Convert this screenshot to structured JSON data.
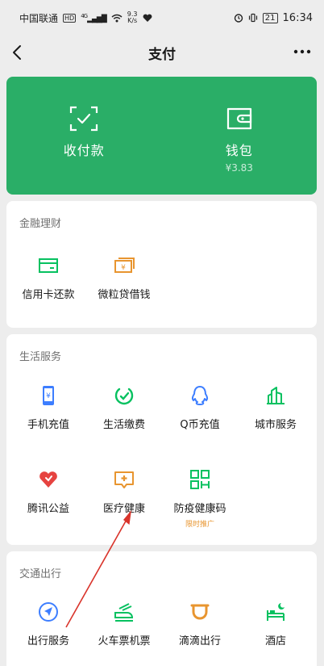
{
  "status_bar": {
    "carrier": "中国联通",
    "hd": "HD",
    "network": "4G",
    "speed_value": "9.3",
    "speed_unit": "K/s",
    "battery": "21",
    "time": "16:34"
  },
  "nav": {
    "title": "支付"
  },
  "hero": {
    "items": [
      {
        "label": "收付款",
        "sub": ""
      },
      {
        "label": "钱包",
        "sub": "¥3.83"
      }
    ]
  },
  "sections": [
    {
      "title": "金融理财",
      "items": [
        {
          "label": "信用卡还款",
          "icon": "credit-card-icon"
        },
        {
          "label": "微粒贷借钱",
          "icon": "loan-icon"
        }
      ]
    },
    {
      "title": "生活服务",
      "items": [
        {
          "label": "手机充值",
          "icon": "phone-recharge-icon"
        },
        {
          "label": "生活缴费",
          "icon": "utility-bill-icon"
        },
        {
          "label": "Q币充值",
          "icon": "qq-coin-icon"
        },
        {
          "label": "城市服务",
          "icon": "city-service-icon"
        },
        {
          "label": "腾讯公益",
          "icon": "charity-heart-icon"
        },
        {
          "label": "医疗健康",
          "icon": "medical-icon"
        },
        {
          "label": "防疫健康码",
          "icon": "qr-code-icon",
          "tag": "限时推广"
        }
      ]
    },
    {
      "title": "交通出行",
      "items": [
        {
          "label": "出行服务",
          "icon": "navigation-icon"
        },
        {
          "label": "火车票机票",
          "icon": "train-icon"
        },
        {
          "label": "滴滴出行",
          "icon": "didi-icon"
        },
        {
          "label": "酒店",
          "icon": "hotel-bed-icon"
        }
      ]
    }
  ],
  "colors": {
    "brand_green": "#2AAE67",
    "icon_green": "#07C160",
    "icon_blue": "#3D7EFF",
    "icon_orange": "#E8952F",
    "icon_red": "#E64340",
    "annotation_red": "#D9342B"
  }
}
